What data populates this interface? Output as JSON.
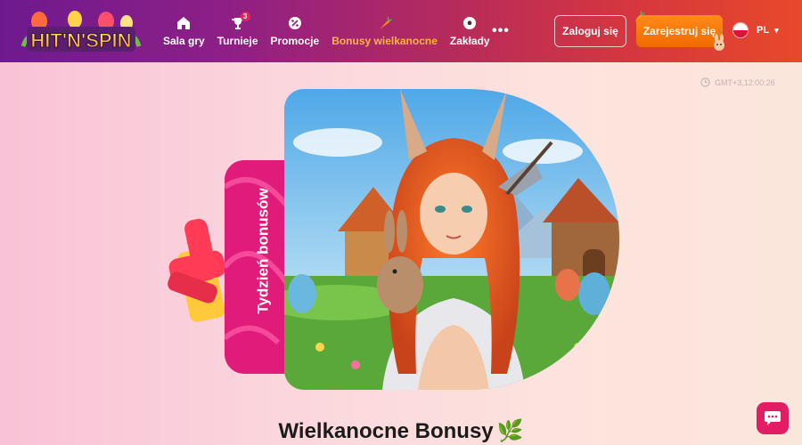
{
  "header": {
    "logo_text": "HIT'N'SPIN",
    "nav": [
      {
        "label": "Sala gry",
        "icon": "home-icon"
      },
      {
        "label": "Turnieje",
        "icon": "trophy-icon",
        "badge": "3"
      },
      {
        "label": "Promocje",
        "icon": "percent-icon"
      },
      {
        "label": "Bonusy wielkanocne",
        "icon": "carrot-icon",
        "active": true
      },
      {
        "label": "Zakłady",
        "icon": "soccer-ball-icon"
      }
    ],
    "more_label": "•••",
    "login_label": "Zaloguj się",
    "register_label": "Zarejestruj się",
    "language": "PL",
    "colors": {
      "active": "#ffb347",
      "register": "#f47a0c",
      "gradient_start": "#6e1a8e",
      "gradient_end": "#e8492a"
    }
  },
  "clock": {
    "text": "GMT+3,12:00:26"
  },
  "hero": {
    "tab_label": "Tydzień bonusów",
    "tab_color": "#e01b7a",
    "image": "easter-warrior-girl-with-rabbit-illustration"
  },
  "title": "Wielkanocne Bonusy",
  "title_icon": "🌿",
  "chat": {
    "icon": "chat-icon",
    "color": "#e11d64"
  }
}
